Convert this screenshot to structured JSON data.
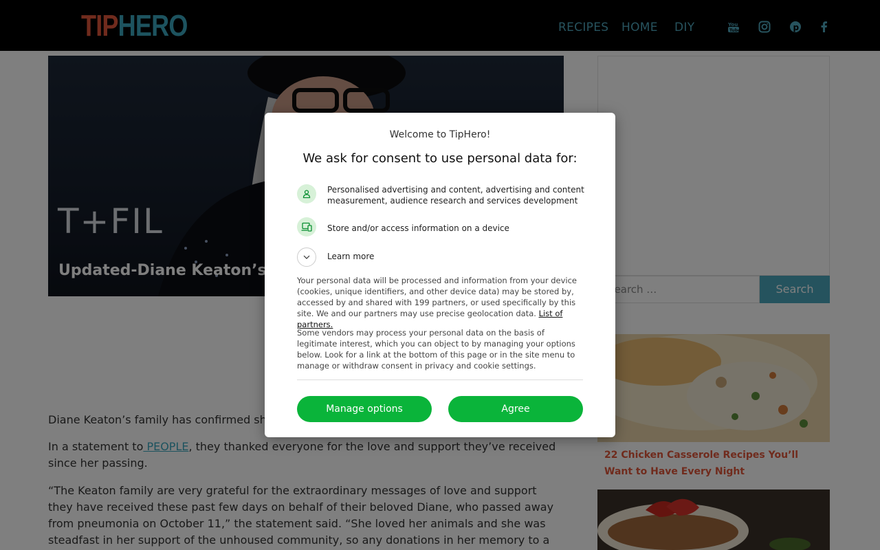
{
  "header": {
    "logo_tip": "TIP",
    "logo_hero": "HERO",
    "nav": [
      "RECIPES",
      "HOME",
      "DIY"
    ],
    "social_icons": [
      "youtube-icon",
      "instagram-icon",
      "pinterest-icon",
      "facebook-icon"
    ]
  },
  "article": {
    "hero_overlay_text": "T+FIL",
    "title": "Updated-Diane Keaton’s Cau",
    "p1": "Diane Keaton’s family has confirmed she c",
    "p2_prefix": "In a statement to",
    "p2_link": " PEOPLE",
    "p2_suffix": ", they thanked everyone for the love and support they’ve received since her passing.",
    "p3": "“The Keaton family are very grateful for the extraordinary messages of love and support they have received these past few days on behalf of their beloved Diane, who passed away from pneumonia on October 11,” the statement said. “She loved her animals and she was steadfast in her support of the unhoused community, so any donations in her memory to a local food bank or an animal"
  },
  "sidebar": {
    "search_placeholder": "Search …",
    "search_button": "Search",
    "card1_title": "22 Chicken Casserole Recipes You’ll Want to Have Every Night"
  },
  "consent": {
    "welcome": "Welcome to TipHero!",
    "heading": "We ask for consent to use personal data for:",
    "purposes": [
      "Personalised advertising and content, advertising and content measurement, audience research and services development",
      "Store and/or access information on a device"
    ],
    "learn_more": "Learn more",
    "para1": "Your personal data will be processed and information from your device (cookies, unique identifiers, and other device data) may be stored by, accessed by and shared with 199 partners, or used specifically by this site. We and our partners may use precise geolocation data.",
    "partners_link": "List of partners.",
    "para2": "Some vendors may process your personal data on the basis of legitimate interest, which you can object to by managing your options below. Look for a link at the bottom of this page or in the site menu to manage or withdraw consent in privacy and cookie settings.",
    "manage_button": "Manage options",
    "agree_button": "Agree"
  }
}
